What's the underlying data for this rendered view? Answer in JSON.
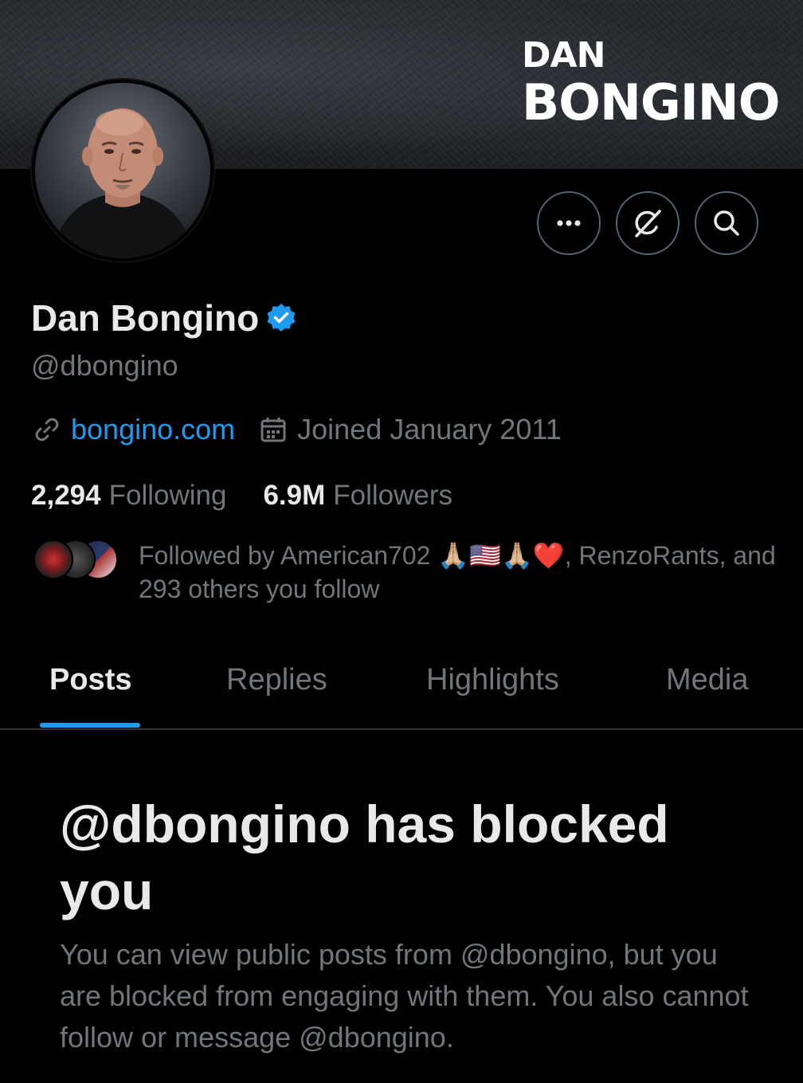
{
  "banner": {
    "title_line1": "DAN",
    "title_line2": "BONGINO"
  },
  "actions": {
    "more_icon": "more-horizontal-icon",
    "grok_icon": "grok-icon",
    "search_icon": "search-icon"
  },
  "profile": {
    "name": "Dan Bongino",
    "verified_icon": "verified-badge-icon",
    "handle": "@dbongino",
    "website": "bongino.com",
    "joined": "Joined January 2011",
    "following_count": "2,294",
    "following_label": "Following",
    "followers_count": "6.9M",
    "followers_label": "Followers",
    "followed_by": "Followed by American702 🙏🏼🇺🇸🙏🏼❤️, RenzoRants, and 293 others you follow"
  },
  "tabs": [
    {
      "label": "Posts",
      "active": true
    },
    {
      "label": "Replies",
      "active": false
    },
    {
      "label": "Highlights",
      "active": false
    },
    {
      "label": "Media",
      "active": false
    }
  ],
  "blocked": {
    "title": "@dbongino has blocked you",
    "description": "You can view public posts from @dbongino, but you are blocked from engaging with them. You also cannot follow or message @dbongino."
  },
  "colors": {
    "accent": "#1d9bf0",
    "secondary_text": "#71767b",
    "primary_text": "#e7e9ea",
    "background": "#000000"
  }
}
